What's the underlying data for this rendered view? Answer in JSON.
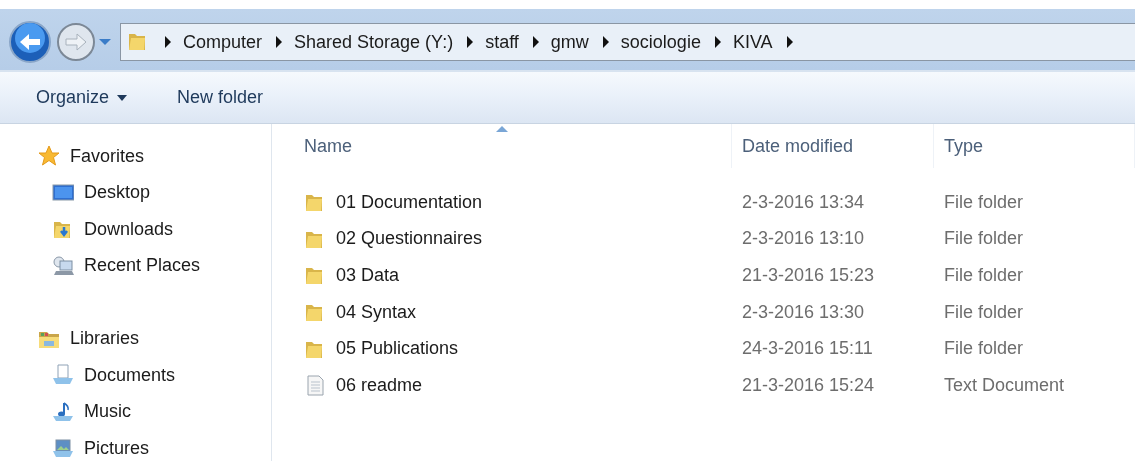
{
  "navigation": {
    "back_enabled": true,
    "forward_enabled": false
  },
  "breadcrumb": [
    "Computer",
    "Shared Storage (Y:)",
    "staff",
    "gmw",
    "sociologie",
    "KIVA"
  ],
  "toolbar": [
    {
      "label": "Organize",
      "dropdown": true
    },
    {
      "label": "New folder",
      "dropdown": false
    }
  ],
  "sidebar": {
    "groups": [
      {
        "label": "Favorites",
        "kind": "favorites",
        "children": [
          {
            "label": "Desktop",
            "kind": "desktop"
          },
          {
            "label": "Downloads",
            "kind": "downloads"
          },
          {
            "label": "Recent Places",
            "kind": "recent"
          }
        ]
      },
      {
        "label": "Libraries",
        "kind": "libraries",
        "children": [
          {
            "label": "Documents",
            "kind": "documents"
          },
          {
            "label": "Music",
            "kind": "music"
          },
          {
            "label": "Pictures",
            "kind": "pictures"
          }
        ]
      }
    ]
  },
  "file_list": {
    "columns": [
      {
        "label": "Name",
        "sorted": true
      },
      {
        "label": "Date modified",
        "sorted": false
      },
      {
        "label": "Type",
        "sorted": false
      }
    ],
    "rows": [
      {
        "name": "01 Documentation",
        "date": "2-3-2016 13:34",
        "type": "File folder",
        "kind": "folder"
      },
      {
        "name": "02 Questionnaires",
        "date": "2-3-2016 13:10",
        "type": "File folder",
        "kind": "folder"
      },
      {
        "name": "03 Data",
        "date": "21-3-2016 15:23",
        "type": "File folder",
        "kind": "folder"
      },
      {
        "name": "04 Syntax",
        "date": "2-3-2016 13:30",
        "type": "File folder",
        "kind": "folder"
      },
      {
        "name": "05 Publications",
        "date": "24-3-2016 15:11",
        "type": "File folder",
        "kind": "folder"
      },
      {
        "name": "06 readme",
        "date": "21-3-2016 15:24",
        "type": "Text Document",
        "kind": "text"
      }
    ]
  }
}
